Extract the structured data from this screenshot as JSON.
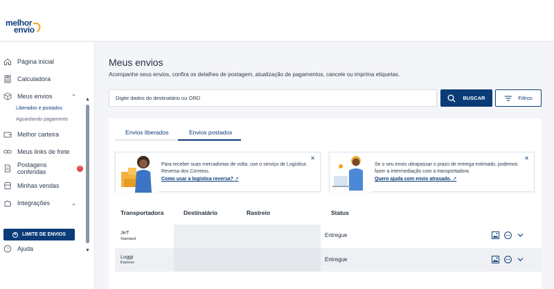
{
  "brand": {
    "line1": "melhor",
    "line2": "envio",
    "accent": "#f3a11a",
    "primary": "#0b3c78"
  },
  "sidebar": {
    "items": [
      {
        "label": "Página inicial",
        "icon": "home-icon"
      },
      {
        "label": "Calculadora",
        "icon": "calculator-icon"
      },
      {
        "label": "Meus envios",
        "icon": "box-icon"
      },
      {
        "label": "Melhor carteira",
        "icon": "wallet-icon"
      },
      {
        "label": "Meus links de frete",
        "icon": "link-icon"
      },
      {
        "label": "Postagens conferidas",
        "icon": "document-icon",
        "badge": "!"
      },
      {
        "label": "Minhas vendas",
        "icon": "store-icon"
      },
      {
        "label": "Integrações",
        "icon": "puzzle-icon"
      }
    ],
    "subitems": [
      {
        "label": "Liberados e postados"
      },
      {
        "label": "Aguardando pagamento"
      }
    ],
    "limit_button": "LIMITE DE ENVIOS",
    "help": "Ajuda"
  },
  "main": {
    "title": "Meus envios",
    "subtitle": "Acompanhe seus envios, confira os detalhes de postagem, atualização de pagamentos, cancele ou imprima etiquetas.",
    "search_placeholder": "Digite dados do destinatário ou ORD",
    "search_button": "BUSCAR",
    "filter_button": "Filtros",
    "tabs": [
      {
        "label": "Envios liberados",
        "active": false
      },
      {
        "label": "Envios postados",
        "active": true
      }
    ],
    "promos": [
      {
        "text": "Para receber suas mercadorias de volta, use o serviço de Logística Reversa dos Correios.",
        "link": "Como usar a logística reversa?"
      },
      {
        "text": "Se o seu envio ultrapassar o prazo de entrega estimado, podemos fazer a intermediação com a transportadora.",
        "link": "Quero ajuda com envio atrasado."
      }
    ],
    "table": {
      "headers": [
        "Transportadora",
        "Destinatário",
        "Rastreio",
        "Status"
      ],
      "rows": [
        {
          "carrier": "JeT",
          "service": "Standard",
          "recipient": "",
          "tracking": "",
          "status": "Entregue"
        },
        {
          "carrier": "Loggi",
          "service": "Express",
          "recipient": "",
          "tracking": "",
          "status": "Entregue"
        }
      ]
    }
  }
}
